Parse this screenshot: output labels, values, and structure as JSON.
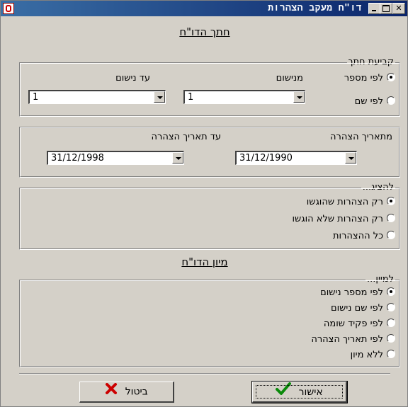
{
  "window": {
    "title": "דו\"ח מעקב הצהרות"
  },
  "report_section": {
    "title": "חתך הדו\"ח",
    "cut_group": {
      "legend": "קביעת חתך",
      "options": [
        "לפי מספר",
        "לפי שם"
      ],
      "selected": 0,
      "from_label": "מנישום",
      "to_label": "עד נישום",
      "from_value": "1",
      "to_value": "1"
    },
    "date_group": {
      "from_label": "מתאריך הצהרה",
      "to_label": "עד תאריך הצהרה",
      "from_value": "31/12/1990",
      "to_value": "31/12/1998"
    },
    "show_group": {
      "legend": "להציג...",
      "options": [
        "רק הצהרות שהוגשו",
        "רק הצהרות שלא הוגשו",
        "כל ההצהרות"
      ],
      "selected": 0
    }
  },
  "sort_section": {
    "title": "מיון הדו\"ח",
    "sort_group": {
      "legend": "למיין...",
      "options": [
        "לפי מספר נישום",
        "לפי שם נישום",
        "לפי פקיד שומה",
        "לפי תאריך הצהרה",
        "ללא מיון"
      ],
      "selected": 0
    }
  },
  "buttons": {
    "ok": "אישור",
    "cancel": "ביטול"
  },
  "colors": {
    "ok_check": "#0a8a0a",
    "cancel_x": "#cc0000",
    "titlebar": "#0a246a"
  }
}
